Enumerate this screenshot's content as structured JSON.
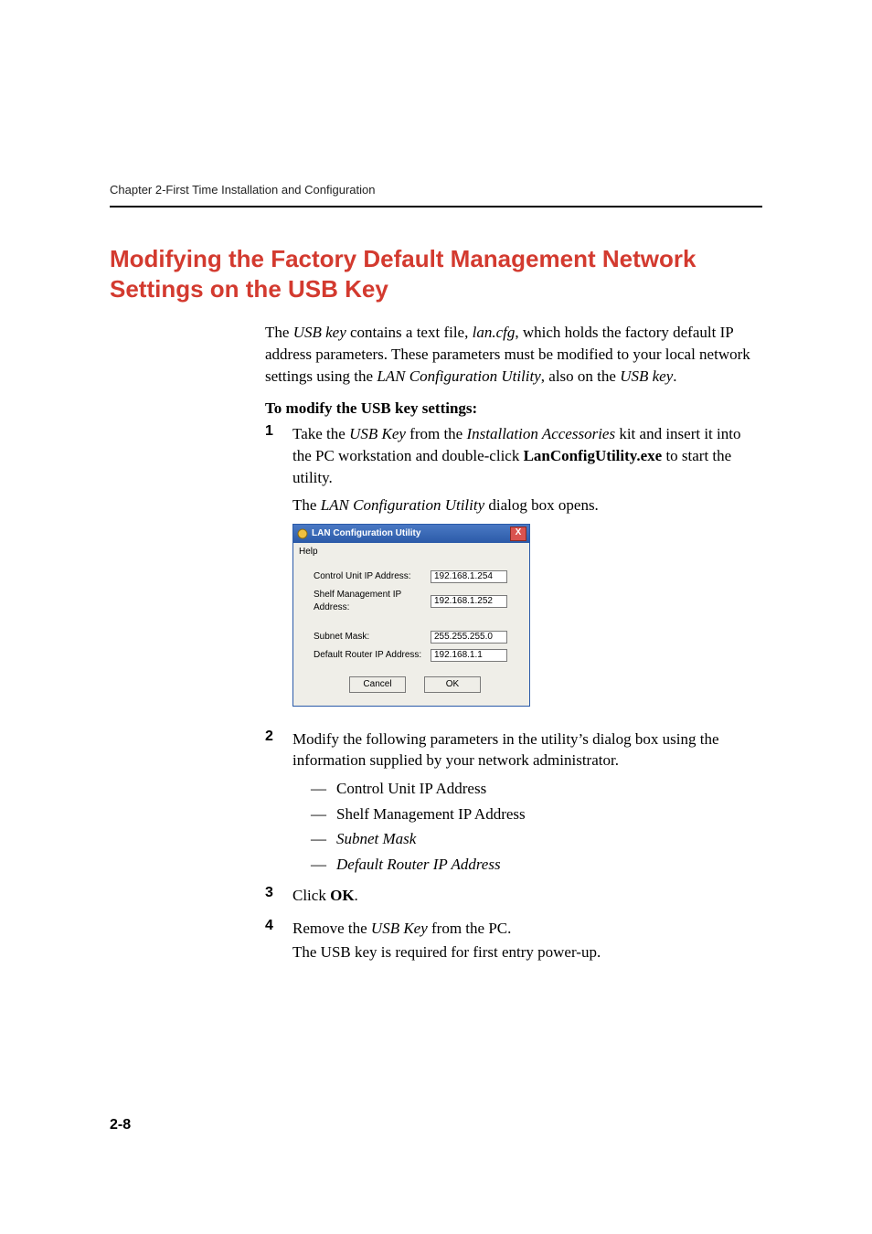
{
  "header": {
    "running_head": "Chapter 2-First Time Installation and Configuration"
  },
  "section": {
    "title": "Modifying the Factory Default Management Network Settings on the USB Key"
  },
  "intro": {
    "p1_a": "The ",
    "p1_b": "USB key",
    "p1_c": " contains a text file, ",
    "p1_d": "lan.cfg",
    "p1_e": ", which holds the factory default IP address parameters. These parameters must be modified to your local network settings using the ",
    "p1_f": "LAN Configuration Utility",
    "p1_g": ", also on the ",
    "p1_h": "USB key",
    "p1_i": "."
  },
  "proc_head": "To modify the USB key settings:",
  "steps": {
    "n1": "1",
    "s1_a": "Take the ",
    "s1_b": "USB Key",
    "s1_c": " from the ",
    "s1_d": "Installation Accessories",
    "s1_e": " kit and insert it into the PC workstation and double-click ",
    "s1_f": "LanConfigUtility.exe",
    "s1_g": " to start the utility.",
    "s1_h_a": "The ",
    "s1_h_b": "LAN Configuration Utility",
    "s1_h_c": " dialog box opens.",
    "n2": "2",
    "s2": "Modify the following parameters in the utility’s dialog box using the information supplied by your network administrator.",
    "s2_items": {
      "a": "Control Unit IP Address",
      "b": "Shelf Management IP Address",
      "c": "Subnet Mask",
      "d": "Default Router IP Address"
    },
    "n3": "3",
    "s3_a": "Click ",
    "s3_b": "OK",
    "s3_c": ".",
    "n4": "4",
    "s4_a": "Remove the ",
    "s4_b": "USB Key",
    "s4_c": " from the PC.",
    "s4_d": "The USB key is required for first entry power-up."
  },
  "dialog": {
    "title": "LAN Configuration Utility",
    "close": "X",
    "help": "Help",
    "labels": {
      "cu": "Control Unit IP Address:",
      "shelf": "Shelf Management IP Address:",
      "subnet": "Subnet Mask:",
      "router": "Default Router IP Address:"
    },
    "values": {
      "cu": "192.168.1.254",
      "shelf": "192.168.1.252",
      "subnet": "255.255.255.0",
      "router": "192.168.1.1"
    },
    "buttons": {
      "cancel": "Cancel",
      "ok": "OK"
    }
  },
  "page_number": "2-8"
}
